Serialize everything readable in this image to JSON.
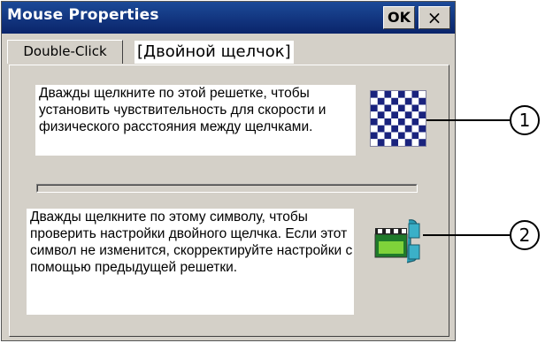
{
  "window": {
    "title": "Mouse Properties",
    "ok_label": "OK",
    "close_label": "×"
  },
  "tabs": [
    {
      "label": "Double-Click"
    }
  ],
  "tab_annotation": "[Двойной щелчок]",
  "grid_section": {
    "description": "Дважды щелкните по этой решетке, чтобы установить чувствительность для скорости и физического расстояния между щелчками."
  },
  "test_section": {
    "description": "Дважды щелкните по этому символу, чтобы проверить настройки двойного щелчка. Если этот символ не изменится, скорректируйте настройки с помощью предыдущей решетки."
  },
  "callouts": [
    {
      "number": "1"
    },
    {
      "number": "2"
    }
  ],
  "colors": {
    "titlebar": "#0a246a",
    "window_bg": "#d4d0c8",
    "checker_dark": "#1a237e",
    "checker_light": "#ffffff"
  }
}
